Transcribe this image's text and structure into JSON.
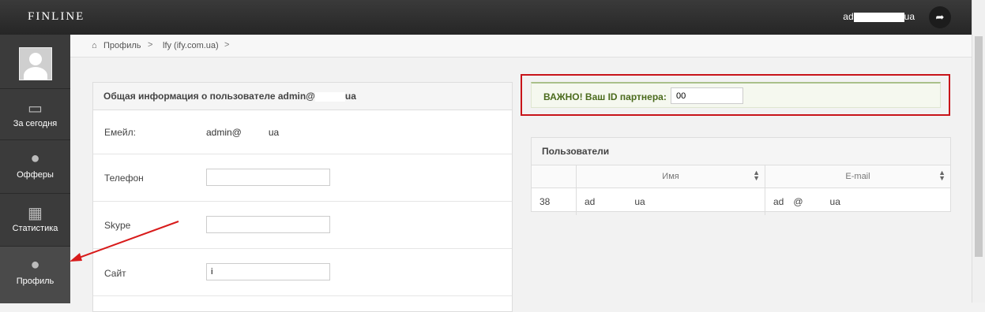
{
  "header": {
    "brand": "FINLINE",
    "user": "ad",
    "user_suffix": "ua",
    "share_icon": "share-arrow-icon"
  },
  "sidebar": {
    "items": [
      {
        "label": "За сегодня",
        "icon": "monitor-icon"
      },
      {
        "label": "Офферы",
        "icon": "lightbulb-icon"
      },
      {
        "label": "Статистика",
        "icon": "bar-chart-icon"
      },
      {
        "label": "Профиль",
        "icon": "user-icon"
      }
    ]
  },
  "breadcrumb": {
    "home": "Профиль",
    "current": "lfy (ify.com.ua)",
    "sep": ">"
  },
  "profile_panel": {
    "title": "Общая информация о пользователе admin@",
    "title_suffix": "ua",
    "email_label": "Емейл:",
    "email_value": "admin@",
    "email_suffix": "ua",
    "phone_label": "Телефон",
    "phone_value": "",
    "skype_label": "Skype",
    "skype_value": "",
    "site_label": "Сайт",
    "site_value": "i"
  },
  "notice": {
    "text": "ВАЖНО! Ваш ID партнера:",
    "partner_id": "00"
  },
  "users_panel": {
    "title": "Пользователи",
    "columns": [
      "",
      "Имя",
      "E-mail"
    ],
    "rows": [
      {
        "id": "38",
        "name": "ad",
        "name_suffix": "ua",
        "email": "ad",
        "email_mid": "@",
        "email_suffix": "ua"
      }
    ]
  },
  "colors": {
    "accent_red": "#c8141a",
    "notice_green": "#4b6b1d"
  }
}
